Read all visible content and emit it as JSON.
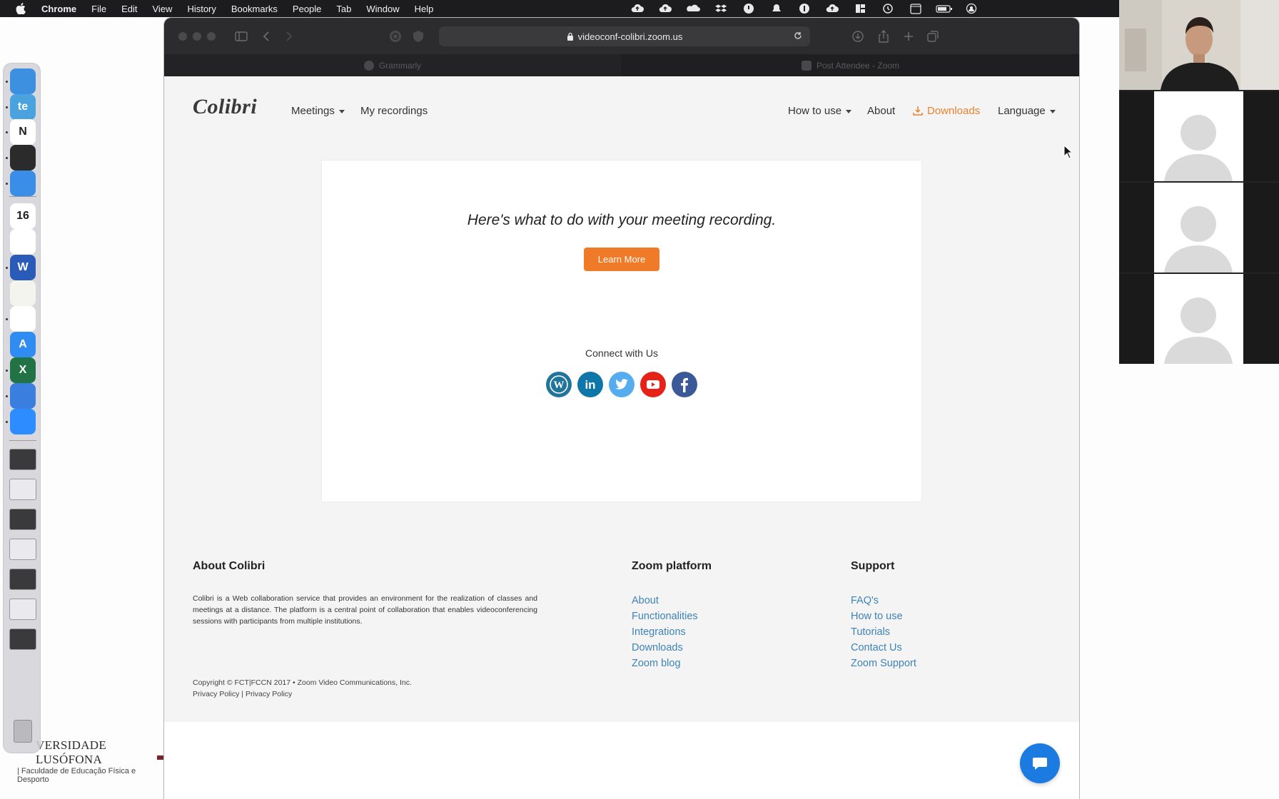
{
  "menubar": {
    "app_name": "Chrome",
    "items": [
      "File",
      "Edit",
      "View",
      "History",
      "Bookmarks",
      "People",
      "Tab",
      "Window",
      "Help"
    ]
  },
  "desktop": {
    "brand_line1": "VERSIDADE LUSÓFONA",
    "brand_line2": "| Faculdade de Educação Física e Desporto"
  },
  "dock": {
    "apps": [
      {
        "name": "finder-icon",
        "color": "#3d8fe0",
        "glyph": ""
      },
      {
        "name": "teams-icon",
        "color": "#4aa3df",
        "glyph": "te"
      },
      {
        "name": "notion-icon",
        "color": "#ffffff",
        "glyph": "N"
      },
      {
        "name": "basketball-app-icon",
        "color": "#2b2b2b",
        "glyph": ""
      },
      {
        "name": "safari-icon",
        "color": "#3b8ee8",
        "glyph": ""
      },
      {
        "name": "calendar-icon",
        "color": "#ffffff",
        "glyph": "16"
      },
      {
        "name": "reminders-icon",
        "color": "#ffffff",
        "glyph": ""
      },
      {
        "name": "word-icon",
        "color": "#2b5bb8",
        "glyph": "W"
      },
      {
        "name": "notes-icon",
        "color": "#f4f4ee",
        "glyph": ""
      },
      {
        "name": "chrome-icon",
        "color": "#ffffff",
        "glyph": ""
      },
      {
        "name": "app-store-icon",
        "color": "#2f8cf0",
        "glyph": "A"
      },
      {
        "name": "excel-icon",
        "color": "#217346",
        "glyph": "X"
      },
      {
        "name": "network-app-icon",
        "color": "#3a7ee0",
        "glyph": ""
      },
      {
        "name": "zoom-icon",
        "color": "#2d8cff",
        "glyph": ""
      }
    ]
  },
  "browser": {
    "url": "videoconf-colibri.zoom.us",
    "tabs": [
      {
        "label": "Grammarly",
        "active": true
      },
      {
        "label": "Post Attendee - Zoom",
        "active": false
      }
    ]
  },
  "site": {
    "logo": "Colibri",
    "nav_left": [
      {
        "label": "Meetings",
        "dropdown": true
      },
      {
        "label": "My recordings",
        "dropdown": false
      }
    ],
    "nav_right": [
      {
        "label": "How to use",
        "dropdown": true
      },
      {
        "label": "About",
        "dropdown": false
      },
      {
        "label": "Downloads",
        "dropdown": false
      },
      {
        "label": "Language",
        "dropdown": true
      }
    ],
    "card": {
      "heading": "Here's what to do with your meeting recording.",
      "button": "Learn More",
      "connect_label": "Connect with Us"
    },
    "socials": [
      {
        "name": "wordpress-icon",
        "color": "#21759b",
        "glyph": "W"
      },
      {
        "name": "linkedin-icon",
        "color": "#0e76a8",
        "glyph": "in"
      },
      {
        "name": "twitter-icon",
        "color": "#55acee",
        "glyph": ""
      },
      {
        "name": "youtube-icon",
        "color": "#e62117",
        "glyph": ""
      },
      {
        "name": "facebook-icon",
        "color": "#3b5998",
        "glyph": "f"
      }
    ],
    "footer": {
      "about_title": "About Colibri",
      "about_text": "Colibri is a Web collaboration service that provides an environment for the realization of classes and meetings at a distance. The platform is a central point of collaboration that enables videoconferencing sessions with participants from multiple institutions.",
      "zoom_title": "Zoom platform",
      "zoom_links": [
        "About",
        "Functionalities",
        "Integrations",
        "Downloads",
        "Zoom blog"
      ],
      "support_title": "Support",
      "support_links": [
        "FAQ's",
        "How to use",
        "Tutorials",
        "Contact Us",
        "Zoom Support"
      ],
      "copyright": "Copyright © FCT|FCCN 2017 • Zoom Video Communications, Inc.",
      "privacy_1": "Privacy Policy",
      "privacy_separator": "|",
      "privacy_2": "Privacy Policy"
    }
  },
  "colors": {
    "accent_orange": "#ef7a27",
    "link_blue": "#3f83b5",
    "chat_blue": "#1c7be0"
  }
}
